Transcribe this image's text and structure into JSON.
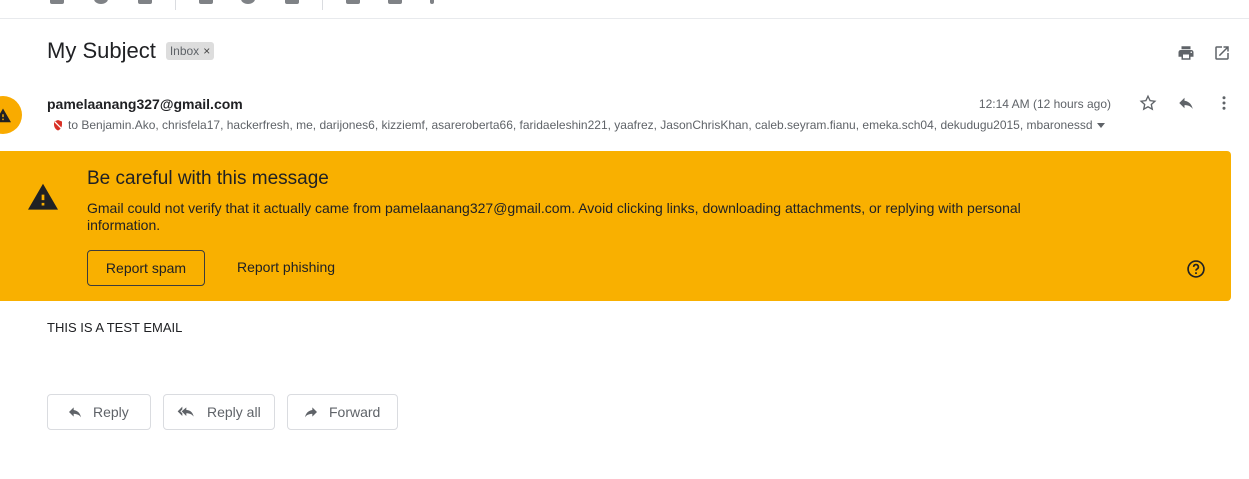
{
  "email": {
    "subject": "My Subject",
    "label": "Inbox",
    "label_close": "×",
    "sender": "pamelaanang327@gmail.com",
    "recipients": "to Benjamin.Ako, chrisfela17, hackerfresh, me, darijones6, kizziemf, asareroberta66, faridaeleshin221, yaafrez, JasonChrisKhan, caleb.seyram.fianu, emeka.sch04, dekudugu2015, mbaronessd",
    "timestamp": "12:14 AM (12 hours ago)",
    "body": "THIS IS A TEST EMAIL"
  },
  "warning": {
    "title": "Be careful with this message",
    "text": "Gmail could not verify that it actually came from pamelaanang327@gmail.com. Avoid clicking links, downloading attachments, or replying with personal information.",
    "report_spam": "Report spam",
    "report_phishing": "Report phishing",
    "background": "#f9b000"
  },
  "actions": {
    "reply": "Reply",
    "reply_all": "Reply all",
    "forward": "Forward"
  },
  "icons": [
    "print-icon",
    "open-in-new-window-icon",
    "warning-icon",
    "star-icon",
    "reply-icon",
    "more-vert-icon",
    "help-icon",
    "reply-all-icon",
    "forward-icon",
    "unverified-sender-icon"
  ]
}
